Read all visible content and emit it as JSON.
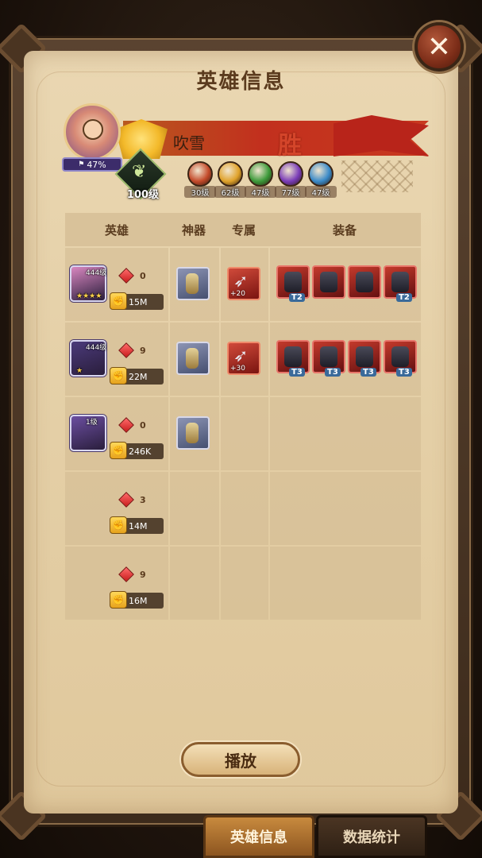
{
  "title": "英雄信息",
  "close": {
    "symbol": "✕"
  },
  "player": {
    "name": "吹雪",
    "result": "胜",
    "progress": "47%",
    "level": "100级"
  },
  "factions": [
    {
      "name": "fire",
      "level": "30级",
      "color": "#c44a2a"
    },
    {
      "name": "light",
      "level": "62级",
      "color": "#e0a22a"
    },
    {
      "name": "nature",
      "level": "47级",
      "color": "#3c9a3a"
    },
    {
      "name": "shadow",
      "level": "77级",
      "color": "#7a3cb8"
    },
    {
      "name": "water",
      "level": "47级",
      "color": "#3a8ac8"
    }
  ],
  "table": {
    "headers": {
      "hero": "英雄",
      "artifact": "神器",
      "exclusive": "专属",
      "equipment": "装备"
    },
    "rows": [
      {
        "hero_level": "444级",
        "stars": "★★★★",
        "gems": "0",
        "power": "15M",
        "hero_color": "#d987c0",
        "has_artifact": true,
        "exclusive_plus": "+20",
        "equipment": [
          "T2",
          "",
          "",
          "T2"
        ]
      },
      {
        "hero_level": "444级",
        "stars": "★",
        "gems": "9",
        "power": "22M",
        "hero_color": "#4b3a7a",
        "has_artifact": true,
        "exclusive_plus": "+30",
        "equipment": [
          "T3",
          "T3",
          "T3",
          "T3"
        ]
      },
      {
        "hero_level": "1级",
        "stars": "",
        "gems": "0",
        "power": "246K",
        "hero_color": "#6b4ea0",
        "has_artifact": true,
        "exclusive_plus": "",
        "equipment": []
      },
      {
        "hero_level": "",
        "stars": "",
        "gems": "3",
        "power": "14M",
        "hero_color": "",
        "has_artifact": false,
        "exclusive_plus": "",
        "equipment": []
      },
      {
        "hero_level": "",
        "stars": "",
        "gems": "9",
        "power": "16M",
        "hero_color": "",
        "has_artifact": false,
        "exclusive_plus": "",
        "equipment": []
      }
    ]
  },
  "play_button": "播放",
  "tabs": {
    "hero_info": "英雄信息",
    "data_stats": "数据统计"
  }
}
